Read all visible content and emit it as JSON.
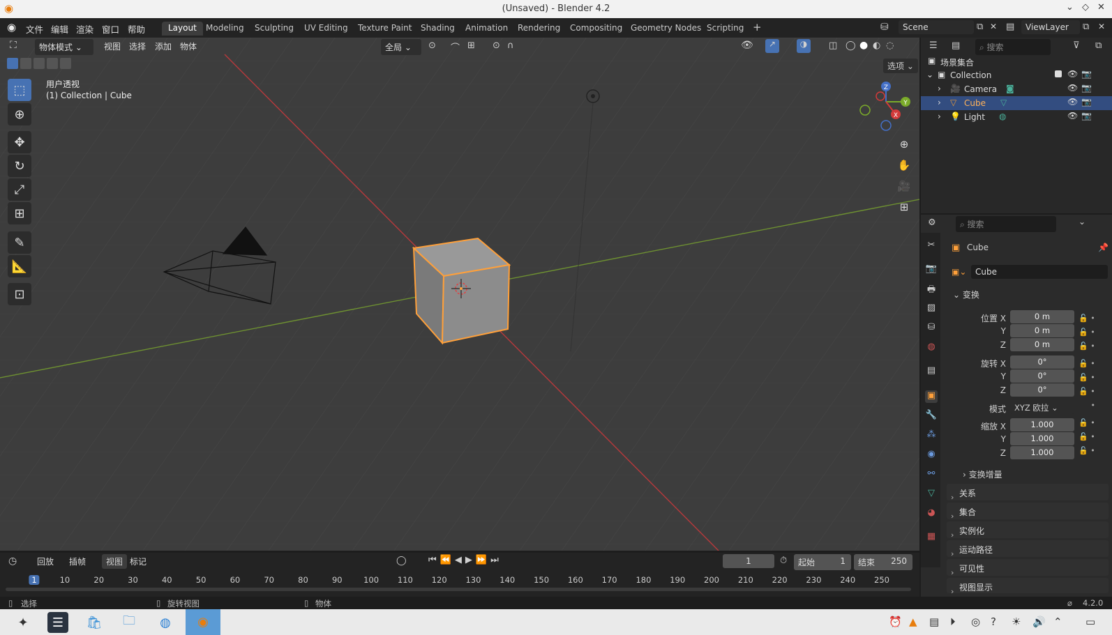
{
  "window": {
    "title": "(Unsaved) - Blender 4.2"
  },
  "menubar": {
    "items": [
      "文件",
      "编辑",
      "渲染",
      "窗口",
      "帮助"
    ]
  },
  "workspaces": {
    "tabs": [
      "Layout",
      "Modeling",
      "Sculpting",
      "UV Editing",
      "Texture Paint",
      "Shading",
      "Animation",
      "Rendering",
      "Compositing",
      "Geometry Nodes",
      "Scripting"
    ],
    "active": "Layout",
    "add": "+"
  },
  "scene": {
    "label": "Scene",
    "viewlayer": "ViewLayer"
  },
  "viewport": {
    "mode": "物体模式",
    "menus": [
      "视图",
      "选择",
      "添加",
      "物体"
    ],
    "orientation": "全局",
    "options": "选项",
    "overlay_title": "用户透视",
    "overlay_subtitle": "(1) Collection | Cube",
    "gizmo": {
      "x": "X",
      "y": "Y",
      "z": "Z"
    }
  },
  "outliner": {
    "search_placeholder": "搜索",
    "scene_collection": "场景集合",
    "items": [
      {
        "name": "Collection"
      },
      {
        "name": "Camera"
      },
      {
        "name": "Cube"
      },
      {
        "name": "Light"
      }
    ]
  },
  "properties": {
    "search_placeholder": "搜索",
    "object_name": "Cube",
    "datablock": "Cube",
    "transform_header": "变换",
    "location_label": "位置 X",
    "rotation_label": "旋转 X",
    "scale_label": "缩放 X",
    "y_label": "Y",
    "z_label": "Z",
    "location": [
      "0 m",
      "0 m",
      "0 m"
    ],
    "rotation": [
      "0°",
      "0°",
      "0°"
    ],
    "mode_label": "模式",
    "mode_value": "XYZ 欧拉",
    "scale": [
      "1.000",
      "1.000",
      "1.000"
    ],
    "delta": "变换增量",
    "sections": [
      "关系",
      "集合",
      "实例化",
      "运动路径",
      "可见性",
      "视图显示"
    ]
  },
  "timeline": {
    "menus": [
      "回放",
      "插帧",
      "视图",
      "标记"
    ],
    "current_frame": "1",
    "start_label": "起始",
    "start": "1",
    "end_label": "结束",
    "end": "250",
    "ticks": [
      "1",
      "10",
      "20",
      "30",
      "40",
      "50",
      "60",
      "70",
      "80",
      "90",
      "100",
      "110",
      "120",
      "130",
      "140",
      "150",
      "160",
      "170",
      "180",
      "190",
      "200",
      "210",
      "220",
      "230",
      "240",
      "250"
    ]
  },
  "statusbar": {
    "select": "选择",
    "rotate": "旋转视图",
    "object": "物体",
    "version": "4.2.0"
  },
  "colors": {
    "accent": "#4772b3",
    "selection": "#ffa03a",
    "x_axis": "#d33a3a",
    "y_axis": "#7bab2a"
  }
}
